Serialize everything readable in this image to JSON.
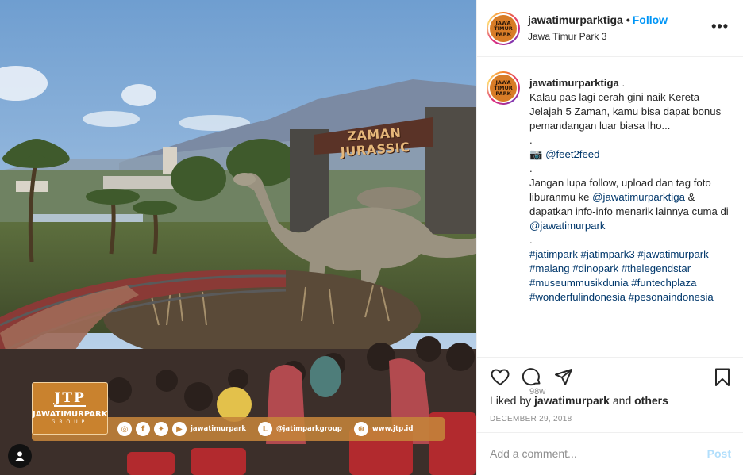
{
  "photo": {
    "gate_sign": "ZAMAN JURASSIC",
    "banner": {
      "logo_mark": "JTP",
      "logo_name": "JAWATIMURPARK",
      "logo_sub": "GROUP",
      "items": [
        {
          "icon": "instagram-icon",
          "text": ""
        },
        {
          "icon": "facebook-icon",
          "text": ""
        },
        {
          "icon": "twitter-icon",
          "text": ""
        },
        {
          "icon": "youtube-icon",
          "text": "jawatimurpark"
        },
        {
          "icon": "line-icon",
          "text": "@jatimparkgroup"
        },
        {
          "icon": "web-icon",
          "text": "www.jtp.id"
        }
      ]
    }
  },
  "header": {
    "username": "jawatimurparktiga",
    "separator": "•",
    "follow_label": "Follow",
    "location": "Jawa Timur Park 3",
    "more_label": "•••"
  },
  "avatar_text": [
    "JAWA",
    "TIMUR",
    "PARK"
  ],
  "caption": {
    "username": "jawatimurparktiga",
    "after_user": " .",
    "intro": "Kalau pas lagi cerah gini naik Kereta Jelajah 5 Zaman, kamu bisa dapat bonus pemandangan luar biasa lho...",
    "dot1": ".",
    "camera_emoji": "📷",
    "credit_handle": "@feet2feed",
    "dot2": ".",
    "body_part1": "Jangan lupa follow, upload dan tag foto liburanmu ke ",
    "body_mention": "@jawatimurparktiga",
    "body_part2": " & dapatkan info-info menarik lainnya cuma di ",
    "body_mention2": "@jawatimurpark",
    "dot3": ".",
    "hashtags": [
      "#jatimpark",
      "#jatimpark3",
      "#jawatimurpark",
      "#malang",
      "#dinopark",
      "#thelegendstar",
      "#museummusikdunia",
      "#funtechplaza",
      "#wonderfulindonesia",
      "#pesonaindonesia"
    ],
    "time_ago": "98w"
  },
  "actions": {
    "like_icon": "heart-icon",
    "comment_icon": "comment-icon",
    "share_icon": "share-icon",
    "save_icon": "bookmark-icon"
  },
  "likes": {
    "prefix": "Liked by ",
    "user": "jawatimurpark",
    "middle": " and ",
    "others": "others"
  },
  "date": "DECEMBER 29, 2018",
  "comment": {
    "placeholder": "Add a comment...",
    "post_label": "Post"
  }
}
